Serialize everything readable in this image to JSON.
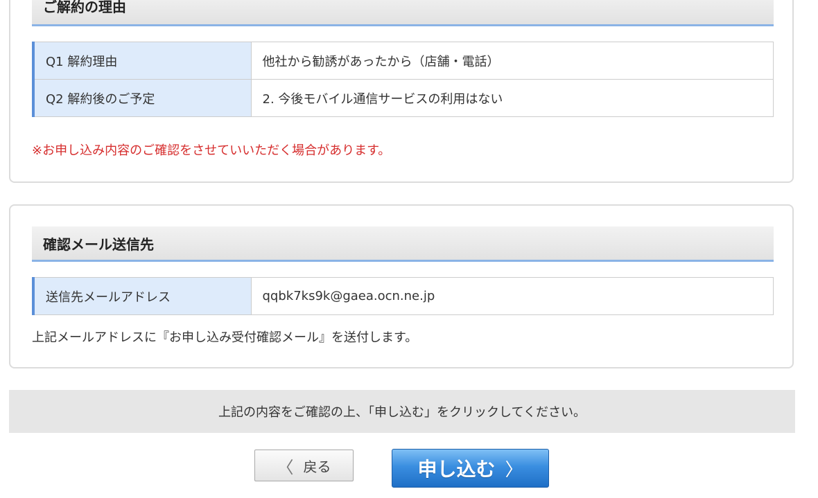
{
  "cancel_reason": {
    "heading": "ご解約の理由",
    "rows": [
      {
        "label": "Q1 解約理由",
        "value": "他社から勧誘があったから（店舗・電話）"
      },
      {
        "label": "Q2 解約後のご予定",
        "value": "2. 今後モバイル通信サービスの利用はない"
      }
    ],
    "notice": "※お申し込み内容のご確認をさせていいただく場合があります。"
  },
  "confirm_mail": {
    "heading": "確認メール送信先",
    "rows": [
      {
        "label": "送信先メールアドレス",
        "value": "qqbk7ks9k@gaea.ocn.ne.jp"
      }
    ],
    "note": "上記メールアドレスに『お申し込み受付確認メール』を送付します。"
  },
  "confirm_bar": {
    "text": "上記の内容をご確認の上、「申し込む」をクリックしてください。"
  },
  "buttons": {
    "back_label": "戻る",
    "back_icon": "chevron-left-icon",
    "submit_label": "申し込む",
    "submit_icon": "chevron-right-icon"
  },
  "colors": {
    "accent_blue": "#5b8fd8",
    "header_underline": "#8ab3e6",
    "label_bg": "#deebfb",
    "notice_red": "#d62d2d",
    "submit_blue": "#2f80d6"
  }
}
